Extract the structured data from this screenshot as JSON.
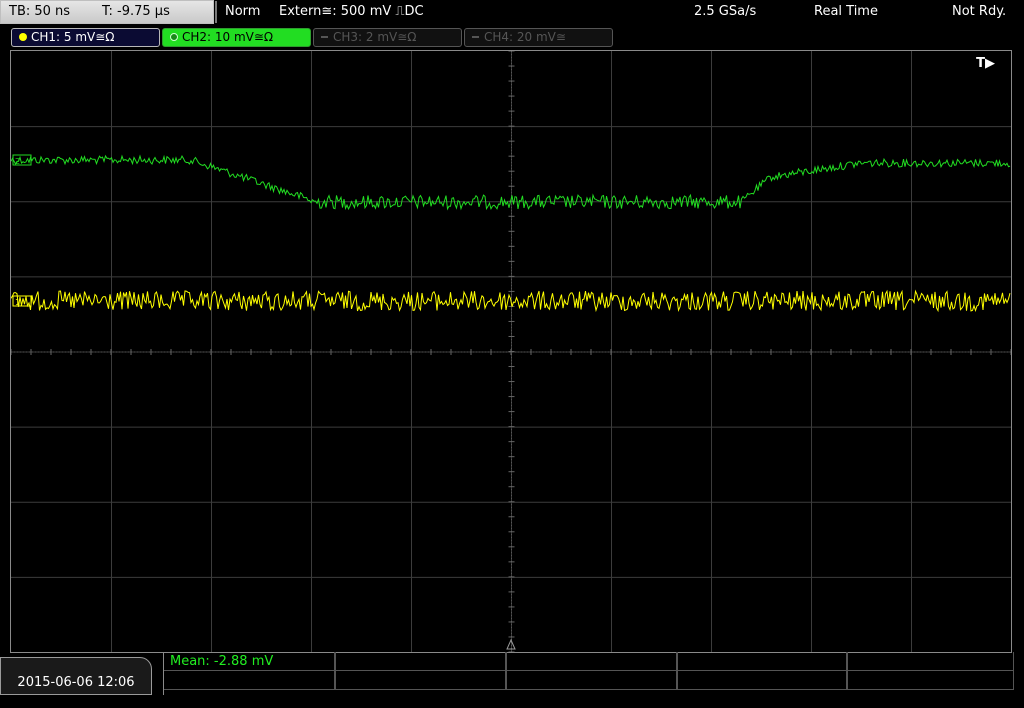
{
  "topbar": {
    "timebase": "TB: 50 ns",
    "trigger_pos": "T: -9.75 µs",
    "mode": "Norm",
    "trigger_source": "Extern≅: 500 mV ⎍DC",
    "sample_rate": "2.5 GSa/s",
    "acquisition": "Real Time",
    "status": "Not Rdy."
  },
  "channels": [
    {
      "label": "CH1: 5 mV≅Ω",
      "color": "#ffff00",
      "active": true
    },
    {
      "label": "CH2: 10 mV≅Ω",
      "color": "#22dd22",
      "active": true
    },
    {
      "label": "CH3: 2 mV≅Ω",
      "color": "#555555",
      "active": false
    },
    {
      "label": "CH4: 20 mV≅",
      "color": "#555555",
      "active": false
    }
  ],
  "screen": {
    "trigger_marker": "T▶",
    "ch1_trace_color": "#ffff00",
    "ch2_trace_color": "#22dd22",
    "grid_color": "#3c3c3c"
  },
  "footer": {
    "datetime": "2015-06-06 12:06",
    "measurement": "Mean: -2.88 mV"
  }
}
